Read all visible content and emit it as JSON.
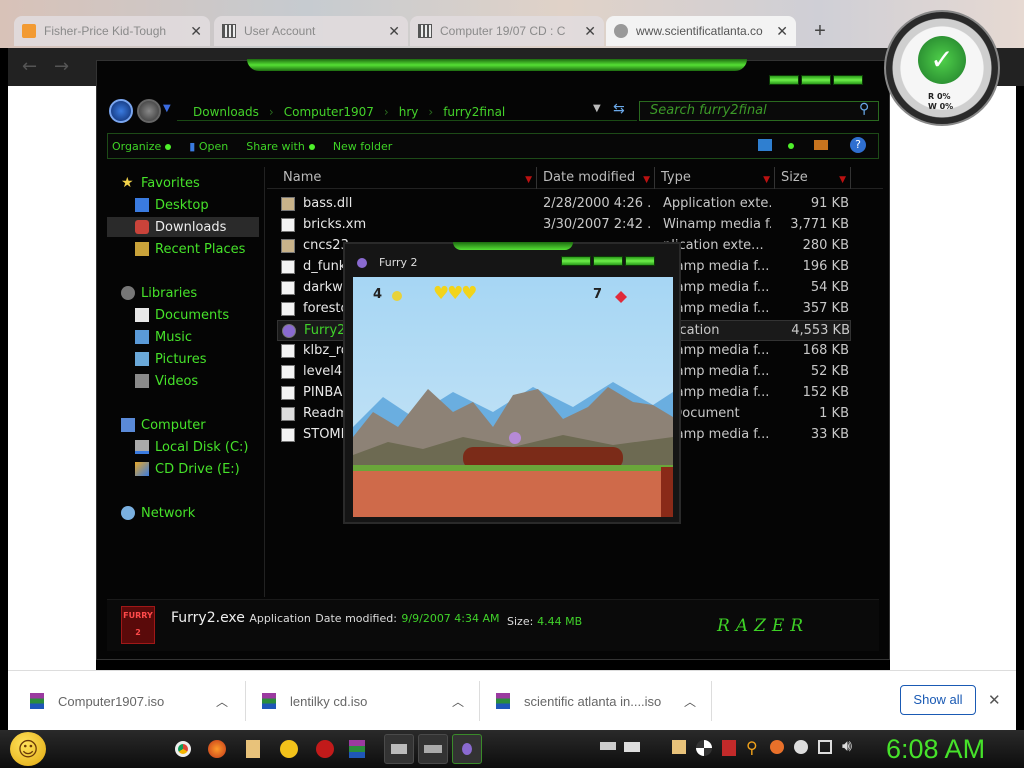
{
  "browser": {
    "tabs": [
      {
        "title": "Fisher-Price Kid-Tough"
      },
      {
        "title": "User Account"
      },
      {
        "title": "Computer 19/07 CD : C"
      },
      {
        "title": "www.scientificatlanta.co"
      }
    ],
    "new_tab_label": "+"
  },
  "explorer": {
    "breadcrumb": [
      "Downloads",
      "Computer1907",
      "hry",
      "furry2final"
    ],
    "search_placeholder": "Search furry2final",
    "commands": {
      "organize": "Organize",
      "open": "Open",
      "share": "Share with",
      "new_folder": "New folder"
    },
    "nav": {
      "favorites": "Favorites",
      "desktop": "Desktop",
      "downloads": "Downloads",
      "recent": "Recent Places",
      "libraries": "Libraries",
      "documents": "Documents",
      "music": "Music",
      "pictures": "Pictures",
      "videos": "Videos",
      "computer": "Computer",
      "local_disk": "Local Disk (C:)",
      "cd_drive": "CD Drive (E:)",
      "network": "Network"
    },
    "columns": {
      "name": "Name",
      "date": "Date modified",
      "type": "Type",
      "size": "Size"
    },
    "files": [
      {
        "name": "bass.dll",
        "date": "2/28/2000 4:26 ...",
        "type": "Application exte...",
        "size": "91 KB"
      },
      {
        "name": "bricks.xm",
        "date": "3/30/2007 2:42 ...",
        "type": "Winamp media f...",
        "size": "3,771 KB"
      },
      {
        "name": "cncs23",
        "date": "",
        "type": "plication exte...",
        "size": "280 KB"
      },
      {
        "name": "d_funk",
        "date": "",
        "type": "mamp media f...",
        "size": "196 KB"
      },
      {
        "name": "darkwo",
        "date": "",
        "type": "mamp media f...",
        "size": "54 KB"
      },
      {
        "name": "foresto",
        "date": "",
        "type": "mamp media f...",
        "size": "357 KB"
      },
      {
        "name": "Furry2",
        "date": "",
        "type": "plication",
        "size": "4,553 KB"
      },
      {
        "name": "klbz_ro",
        "date": "",
        "type": "mamp media f...",
        "size": "168 KB"
      },
      {
        "name": "level4.r",
        "date": "",
        "type": "mamp media f...",
        "size": "52 KB"
      },
      {
        "name": "PINBA",
        "date": "",
        "type": "mamp media f...",
        "size": "152 KB"
      },
      {
        "name": "Readm",
        "date": "",
        "type": "t Document",
        "size": "1 KB"
      },
      {
        "name": "STOMI",
        "date": "",
        "type": "mamp media f...",
        "size": "33 KB"
      }
    ],
    "details": {
      "filename": "Furry2.exe",
      "kind": "Application",
      "date_label": "Date modified:",
      "date_value": "9/9/2007 4:34 AM",
      "size_label": "Size:",
      "size_value": "4.44 MB",
      "icon_text": "FURRY 2",
      "brand": "RAZER"
    }
  },
  "game_window": {
    "title": "Furry 2",
    "lives": "4",
    "gems": "7",
    "hearts": 3
  },
  "downloads": {
    "items": [
      {
        "name": "Computer1907.iso"
      },
      {
        "name": "lentilky cd.iso"
      },
      {
        "name": "scientific atlanta in....iso"
      }
    ],
    "show_all": "Show all",
    "close": "✕"
  },
  "gauge": {
    "read": "R 0%",
    "write": "W 0%"
  },
  "taskbar": {
    "clock": "6:08 AM"
  },
  "colors": {
    "accent_green": "#46e22a",
    "explorer_bg": "#050505",
    "chrome_blue": "#1a5ab4"
  }
}
